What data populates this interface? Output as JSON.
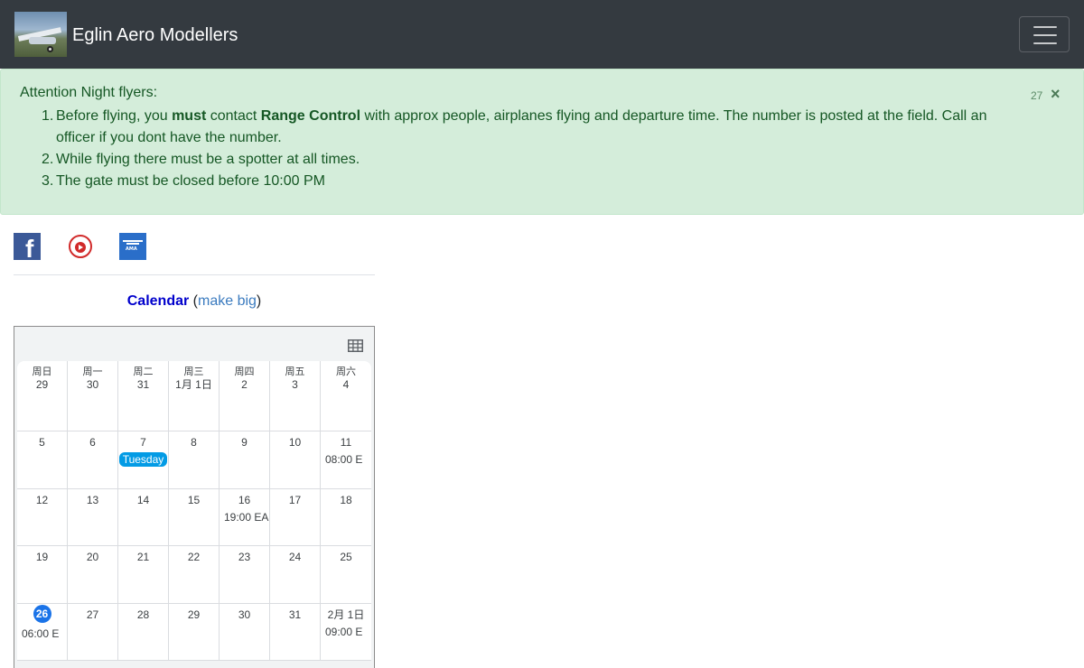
{
  "navbar": {
    "brand_name": "Eglin Aero Modellers",
    "toggler_icon": "hamburger-menu-icon"
  },
  "alert": {
    "title": "Attention Night flyers:",
    "items": [
      {
        "num": "1.",
        "before": "Before flying, you ",
        "must": "must",
        "mid": " contact ",
        "range": "Range Control",
        "after": " with approx people, airplanes flying and departure time. The number is posted at the field. Call an officer if you dont have the number."
      },
      {
        "num": "2.",
        "text": "While flying there must be a spotter at all times."
      },
      {
        "num": "3.",
        "text": "The gate must be closed before 10:00 PM"
      }
    ],
    "count": "27",
    "close": "×"
  },
  "social": {
    "facebook": "f",
    "ama": "AMA"
  },
  "calendar": {
    "title": "Calendar",
    "open_paren": " (",
    "make_big": "make big",
    "close_paren": ")",
    "weekdays": [
      "周日",
      "周一",
      "周二",
      "周三",
      "周四",
      "周五",
      "周六"
    ],
    "weeks": [
      [
        {
          "date": "29"
        },
        {
          "date": "30"
        },
        {
          "date": "31"
        },
        {
          "date": "1月 1日"
        },
        {
          "date": "2"
        },
        {
          "date": "3"
        },
        {
          "date": "4"
        }
      ],
      [
        {
          "date": "5"
        },
        {
          "date": "6"
        },
        {
          "date": "7",
          "chip": "Tuesday"
        },
        {
          "date": "8"
        },
        {
          "date": "9"
        },
        {
          "date": "10"
        },
        {
          "date": "11",
          "event": "08:00 E"
        }
      ],
      [
        {
          "date": "12"
        },
        {
          "date": "13"
        },
        {
          "date": "14"
        },
        {
          "date": "15"
        },
        {
          "date": "16",
          "event": "19:00 EA"
        },
        {
          "date": "17"
        },
        {
          "date": "18"
        }
      ],
      [
        {
          "date": "19"
        },
        {
          "date": "20"
        },
        {
          "date": "21"
        },
        {
          "date": "22"
        },
        {
          "date": "23"
        },
        {
          "date": "24"
        },
        {
          "date": "25"
        }
      ],
      [
        {
          "date": "26",
          "today": true,
          "event": "06:00 E"
        },
        {
          "date": "27"
        },
        {
          "date": "28"
        },
        {
          "date": "29"
        },
        {
          "date": "30"
        },
        {
          "date": "31"
        },
        {
          "date": "2月 1日",
          "event": "09:00 E"
        }
      ]
    ],
    "colors": {
      "today": "#1a73e8",
      "chip": "#039be5"
    }
  }
}
